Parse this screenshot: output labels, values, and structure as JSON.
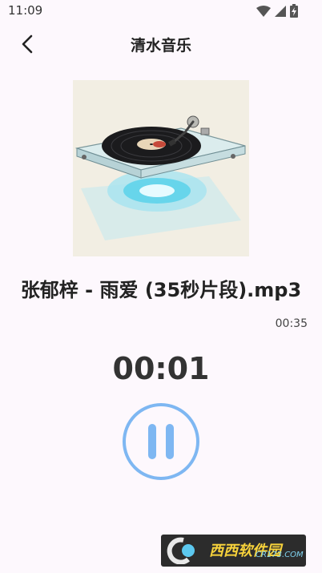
{
  "status_bar": {
    "time": "11:09",
    "icons": [
      "wifi-icon",
      "cell-signal-icon",
      "battery-charging-icon"
    ]
  },
  "app_bar": {
    "title": "清水音乐",
    "back_icon": "chevron-left-icon"
  },
  "player": {
    "cover_icon": "turntable-illustration",
    "song_title": "张郁梓 - 雨爱 (35秒片段).mp3",
    "duration": "00:35",
    "current_time": "00:01",
    "control_icon": "pause-icon"
  },
  "watermark": {
    "text": "西西软件园",
    "site": "CR173.COM"
  },
  "colors": {
    "background": "#fdf8fd",
    "accent": "#7eb7f2",
    "text": "#222222"
  }
}
